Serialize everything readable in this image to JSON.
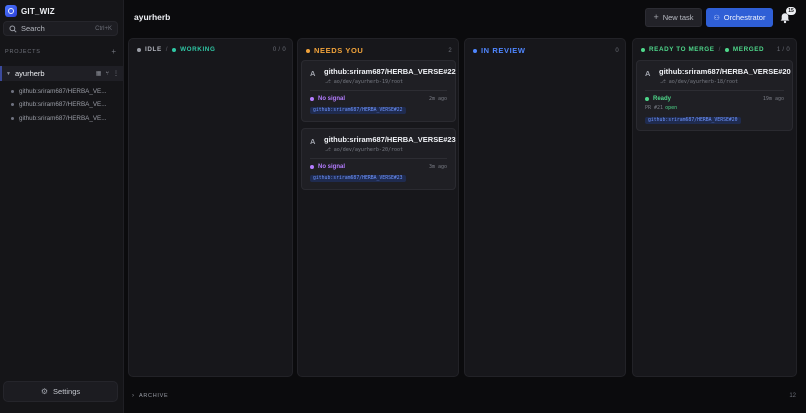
{
  "app": {
    "name": "GIT_WIZ"
  },
  "search": {
    "placeholder": "Search",
    "shortcut": "Ctrl+K"
  },
  "sidebar": {
    "section_label": "PROJECTS",
    "add_symbol": "+",
    "project": {
      "name": "ayurherb"
    },
    "branches": [
      {
        "label": "github:sriram687/HERBA_VE..."
      },
      {
        "label": "github:sriram687/HERBA_VE..."
      },
      {
        "label": "github:sriram687/HERBA_VE..."
      }
    ],
    "settings_label": "Settings"
  },
  "header": {
    "title": "ayurherb",
    "new_task_label": "New task",
    "orchestrator_label": "Orchestrator",
    "notifications_count": "15"
  },
  "colors": {
    "idle": "#9a9da6",
    "working": "#2fc6a4",
    "needs_you": "#f0a23a",
    "in_review": "#4f86ff",
    "ready_to_merge": "#4ed78a",
    "merged": "#4ed78a",
    "no_signal": "#b47cff",
    "accent": "#2f5fd6"
  },
  "columns": {
    "idle": {
      "label": "IDLE",
      "label2": "WORKING",
      "count": "0 / 0"
    },
    "needs_you": {
      "label": "NEEDS YOU",
      "count": "2",
      "cards": [
        {
          "avatar": "A",
          "title": "github:sriram687/HERBA_VERSE#22",
          "path": "ao/dev/ayurherb-19/root",
          "signal": "No signal",
          "ago": "2m ago",
          "branch": "github:sriram687/HERBA_VERSE#22"
        },
        {
          "avatar": "A",
          "title": "github:sriram687/HERBA_VERSE#23",
          "path": "ao/dev/ayurherb-20/root",
          "signal": "No signal",
          "ago": "3m ago",
          "branch": "github:sriram687/HERBA_VERSE#23"
        }
      ]
    },
    "in_review": {
      "label": "IN REVIEW",
      "count": "0"
    },
    "ready": {
      "label": "READY TO MERGE",
      "label2": "MERGED",
      "count": "1 / 0",
      "cards": [
        {
          "avatar": "A",
          "title": "github:sriram687/HERBA_VERSE#20",
          "path": "ao/dev/ayurherb-18/root",
          "signal": "Ready",
          "ago": "19m ago",
          "pr_label": "PR #21",
          "pr_state": "open",
          "branch": "github:sriram687/HERBA_VERSE#20"
        }
      ]
    }
  },
  "archive": {
    "label": "ARCHIVE",
    "count": "12"
  }
}
